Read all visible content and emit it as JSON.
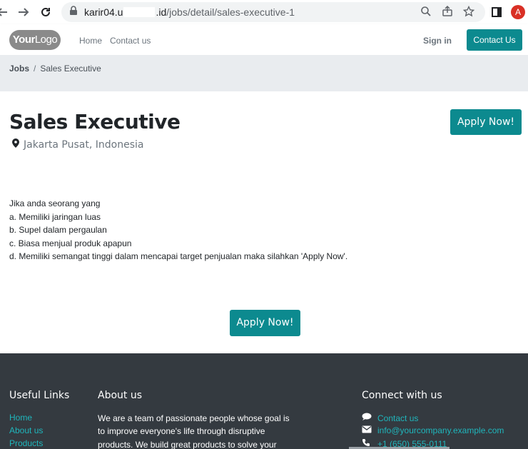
{
  "browser": {
    "url_host_prefix": "karir04.u",
    "url_host_suffix": ".id",
    "url_path": "/jobs/detail/sales-executive-1",
    "avatar_letter": "A",
    "back_icon": "arrow-left-icon",
    "forward_icon": "arrow-right-icon",
    "reload_icon": "reload-icon",
    "lock_icon": "lock-icon",
    "zoom_icon": "magnifier-icon",
    "share_icon": "share-icon",
    "star_icon": "star-icon",
    "sidepanel_icon": "side-panel-icon"
  },
  "header": {
    "logo_bold": "Your",
    "logo_thin": "Logo",
    "nav": [
      "Home",
      "Contact us"
    ],
    "signin": "Sign in",
    "contact_button": "Contact Us",
    "accent_color": "#0c8a8f"
  },
  "breadcrumb": {
    "parent": "Jobs",
    "separator": "/",
    "current": "Sales Executive"
  },
  "job": {
    "title": "Sales Executive",
    "location": "Jakarta Pusat, Indonesia",
    "location_icon": "map-marker-icon",
    "apply_label": "Apply Now!",
    "description": [
      "Jika anda seorang yang",
      "a. Memiliki jaringan luas",
      "b. Supel dalam pergaulan",
      "c. Biasa menjual produk apapun",
      "d. Memiliki semangat tinggi dalam mencapai target penjualan maka silahkan 'Apply Now'."
    ]
  },
  "footer": {
    "useful_links_title": "Useful Links",
    "useful_links": [
      "Home",
      "About us",
      "Products"
    ],
    "about_title": "About us",
    "about_lines": [
      "We are a team of passionate people whose goal is",
      "to improve everyone's life through disruptive",
      "products. We build great products to solve your"
    ],
    "connect_title": "Connect with us",
    "contact_us_label": "Contact us",
    "email": "info@yourcompany.example.com",
    "phone": "+1 (650) 555-0111",
    "link_color": "#1fb6bc",
    "background_color": "#343a40"
  }
}
